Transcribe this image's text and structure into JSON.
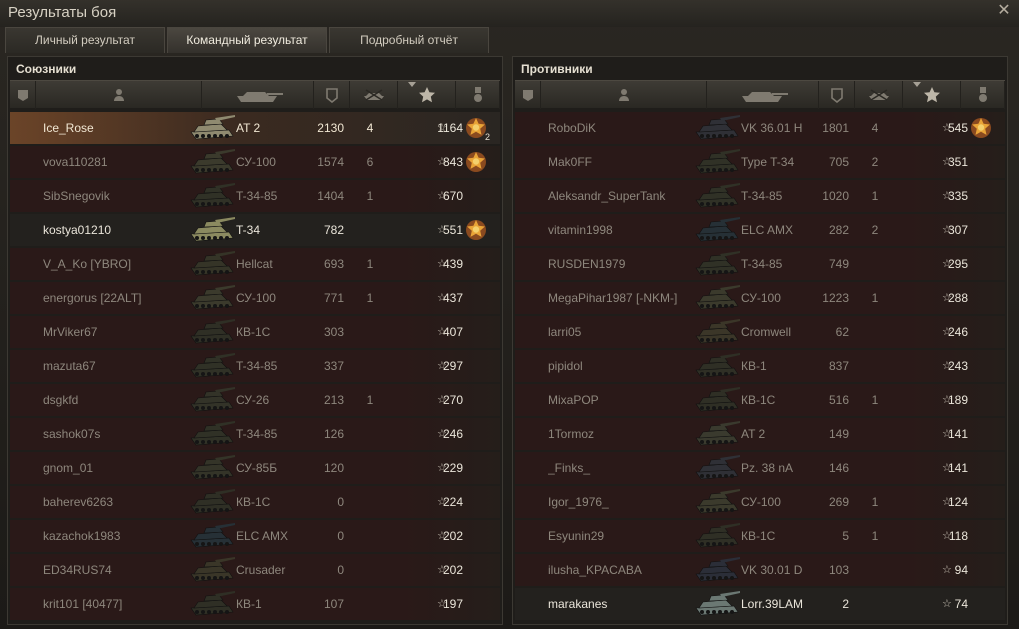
{
  "window": {
    "title": "Результаты боя"
  },
  "tabs": [
    {
      "label": "Личный результат",
      "active": false
    },
    {
      "label": "Командный результат",
      "active": true
    },
    {
      "label": "Подробный отчёт",
      "active": false
    }
  ],
  "icons": {
    "close": "close-icon",
    "header": [
      "tier-icon",
      "player-icon",
      "vehicle-icon",
      "damage-icon",
      "kills-icon",
      "experience-star-icon",
      "medal-icon"
    ],
    "row_star": "star-icon",
    "row_medal": "medal-icon"
  },
  "allies": {
    "title": "Союзники",
    "rows": [
      {
        "name": "Ice_Rose",
        "tank": "AT 2",
        "damage": "2130",
        "kills": "4",
        "xp": "1164",
        "medal": true,
        "medal_count": "2",
        "state": "me",
        "tank_color": "#8f8a70"
      },
      {
        "name": "vova110281",
        "tank": "СУ-100",
        "damage": "1574",
        "kills": "6",
        "xp": "843",
        "medal": true,
        "state": "dead",
        "tank_color": "#3b3a2c"
      },
      {
        "name": "SibSnegovik",
        "tank": "T-34-85",
        "damage": "1404",
        "kills": "1",
        "xp": "670",
        "medal": false,
        "state": "dead",
        "tank_color": "#303126"
      },
      {
        "name": "kostya01210",
        "tank": "T-34",
        "damage": "782",
        "kills": "",
        "xp": "551",
        "medal": true,
        "state": "team",
        "tank_color": "#8b8a60"
      },
      {
        "name": "V_A_Ko [YBRO]",
        "tank": "Hellcat",
        "damage": "693",
        "kills": "1",
        "xp": "439",
        "medal": false,
        "state": "dead",
        "tank_color": "#353427"
      },
      {
        "name": "energorus [22ALT]",
        "tank": "СУ-100",
        "damage": "771",
        "kills": "1",
        "xp": "437",
        "medal": false,
        "state": "dead",
        "tank_color": "#3b3a2c"
      },
      {
        "name": "MrViker67",
        "tank": "КВ-1С",
        "damage": "303",
        "kills": "",
        "xp": "407",
        "medal": false,
        "state": "dead",
        "tank_color": "#2f2f25"
      },
      {
        "name": "mazuta67",
        "tank": "T-34-85",
        "damage": "337",
        "kills": "",
        "xp": "297",
        "medal": false,
        "state": "dead",
        "tank_color": "#303126"
      },
      {
        "name": "dsgkfd",
        "tank": "СУ-26",
        "damage": "213",
        "kills": "1",
        "xp": "270",
        "medal": false,
        "state": "dead",
        "tank_color": "#333328"
      },
      {
        "name": "sashok07s",
        "tank": "T-34-85",
        "damage": "126",
        "kills": "",
        "xp": "246",
        "medal": false,
        "state": "dead",
        "tank_color": "#303126"
      },
      {
        "name": "gnom_01",
        "tank": "СУ-85Б",
        "damage": "120",
        "kills": "",
        "xp": "229",
        "medal": false,
        "state": "dead",
        "tank_color": "#343428"
      },
      {
        "name": "baherev6263",
        "tank": "КВ-1С",
        "damage": "0",
        "kills": "",
        "xp": "224",
        "medal": false,
        "state": "dead",
        "tank_color": "#2f2f25"
      },
      {
        "name": "kazachok1983",
        "tank": "ELC AMX",
        "damage": "0",
        "kills": "",
        "xp": "202",
        "medal": false,
        "state": "dead",
        "tank_color": "#263036"
      },
      {
        "name": "ED34RUS74",
        "tank": "Crusader",
        "damage": "0",
        "kills": "",
        "xp": "202",
        "medal": false,
        "state": "dead",
        "tank_color": "#3a3628"
      },
      {
        "name": "krit101 [40477]",
        "tank": "КВ-1",
        "damage": "107",
        "kills": "",
        "xp": "197",
        "medal": false,
        "state": "dead",
        "tank_color": "#2f2f25"
      }
    ]
  },
  "enemies": {
    "title": "Противники",
    "rows": [
      {
        "name": "RoboDiK",
        "tank": "VK 36.01 H",
        "damage": "1801",
        "kills": "4",
        "xp": "545",
        "medal": true,
        "state": "dead",
        "tank_color": "#2f3036"
      },
      {
        "name": "Mak0FF",
        "tank": "Type T-34",
        "damage": "705",
        "kills": "2",
        "xp": "351",
        "medal": false,
        "state": "dead",
        "tank_color": "#303126"
      },
      {
        "name": "Aleksandr_SuperTank",
        "tank": "T-34-85",
        "damage": "1020",
        "kills": "1",
        "xp": "335",
        "medal": false,
        "state": "dead",
        "tank_color": "#303126"
      },
      {
        "name": "vitamin1998",
        "tank": "ELC AMX",
        "damage": "282",
        "kills": "2",
        "xp": "307",
        "medal": false,
        "state": "dead",
        "tank_color": "#263036"
      },
      {
        "name": "RUSDEN1979",
        "tank": "T-34-85",
        "damage": "749",
        "kills": "",
        "xp": "295",
        "medal": false,
        "state": "dead",
        "tank_color": "#303126"
      },
      {
        "name": "MegaPihar1987 [-NKM-]",
        "tank": "СУ-100",
        "damage": "1223",
        "kills": "1",
        "xp": "288",
        "medal": false,
        "state": "dead",
        "tank_color": "#3b3a2c"
      },
      {
        "name": "larri05",
        "tank": "Cromwell",
        "damage": "62",
        "kills": "",
        "xp": "246",
        "medal": false,
        "state": "dead",
        "tank_color": "#3b3628"
      },
      {
        "name": "pipidol",
        "tank": "КВ-1",
        "damage": "837",
        "kills": "",
        "xp": "243",
        "medal": false,
        "state": "dead",
        "tank_color": "#2f2f25"
      },
      {
        "name": "MixaPOP",
        "tank": "КВ-1С",
        "damage": "516",
        "kills": "1",
        "xp": "189",
        "medal": false,
        "state": "dead",
        "tank_color": "#2f2f25"
      },
      {
        "name": "1Tormoz",
        "tank": "AT 2",
        "damage": "149",
        "kills": "",
        "xp": "141",
        "medal": false,
        "state": "dead",
        "tank_color": "#3a3a2e"
      },
      {
        "name": "_Finks_",
        "tank": "Pz. 38 nA",
        "damage": "146",
        "kills": "",
        "xp": "141",
        "medal": false,
        "state": "dead",
        "tank_color": "#2f3036"
      },
      {
        "name": "Igor_1976_",
        "tank": "СУ-100",
        "damage": "269",
        "kills": "1",
        "xp": "124",
        "medal": false,
        "state": "dead",
        "tank_color": "#3b3a2c"
      },
      {
        "name": "Esyunin29",
        "tank": "КВ-1С",
        "damage": "5",
        "kills": "1",
        "xp": "118",
        "medal": false,
        "state": "dead",
        "tank_color": "#2f2f25"
      },
      {
        "name": "ilusha_KPACABA",
        "tank": "VK 30.01 D",
        "damage": "103",
        "kills": "",
        "xp": "94",
        "medal": false,
        "state": "dead",
        "tank_color": "#2b2e38"
      },
      {
        "name": "marakanes",
        "tank": "Lorr.39LAM",
        "damage": "2",
        "kills": "",
        "xp": "74",
        "medal": false,
        "state": "team",
        "tank_color": "#6b7873"
      }
    ]
  }
}
